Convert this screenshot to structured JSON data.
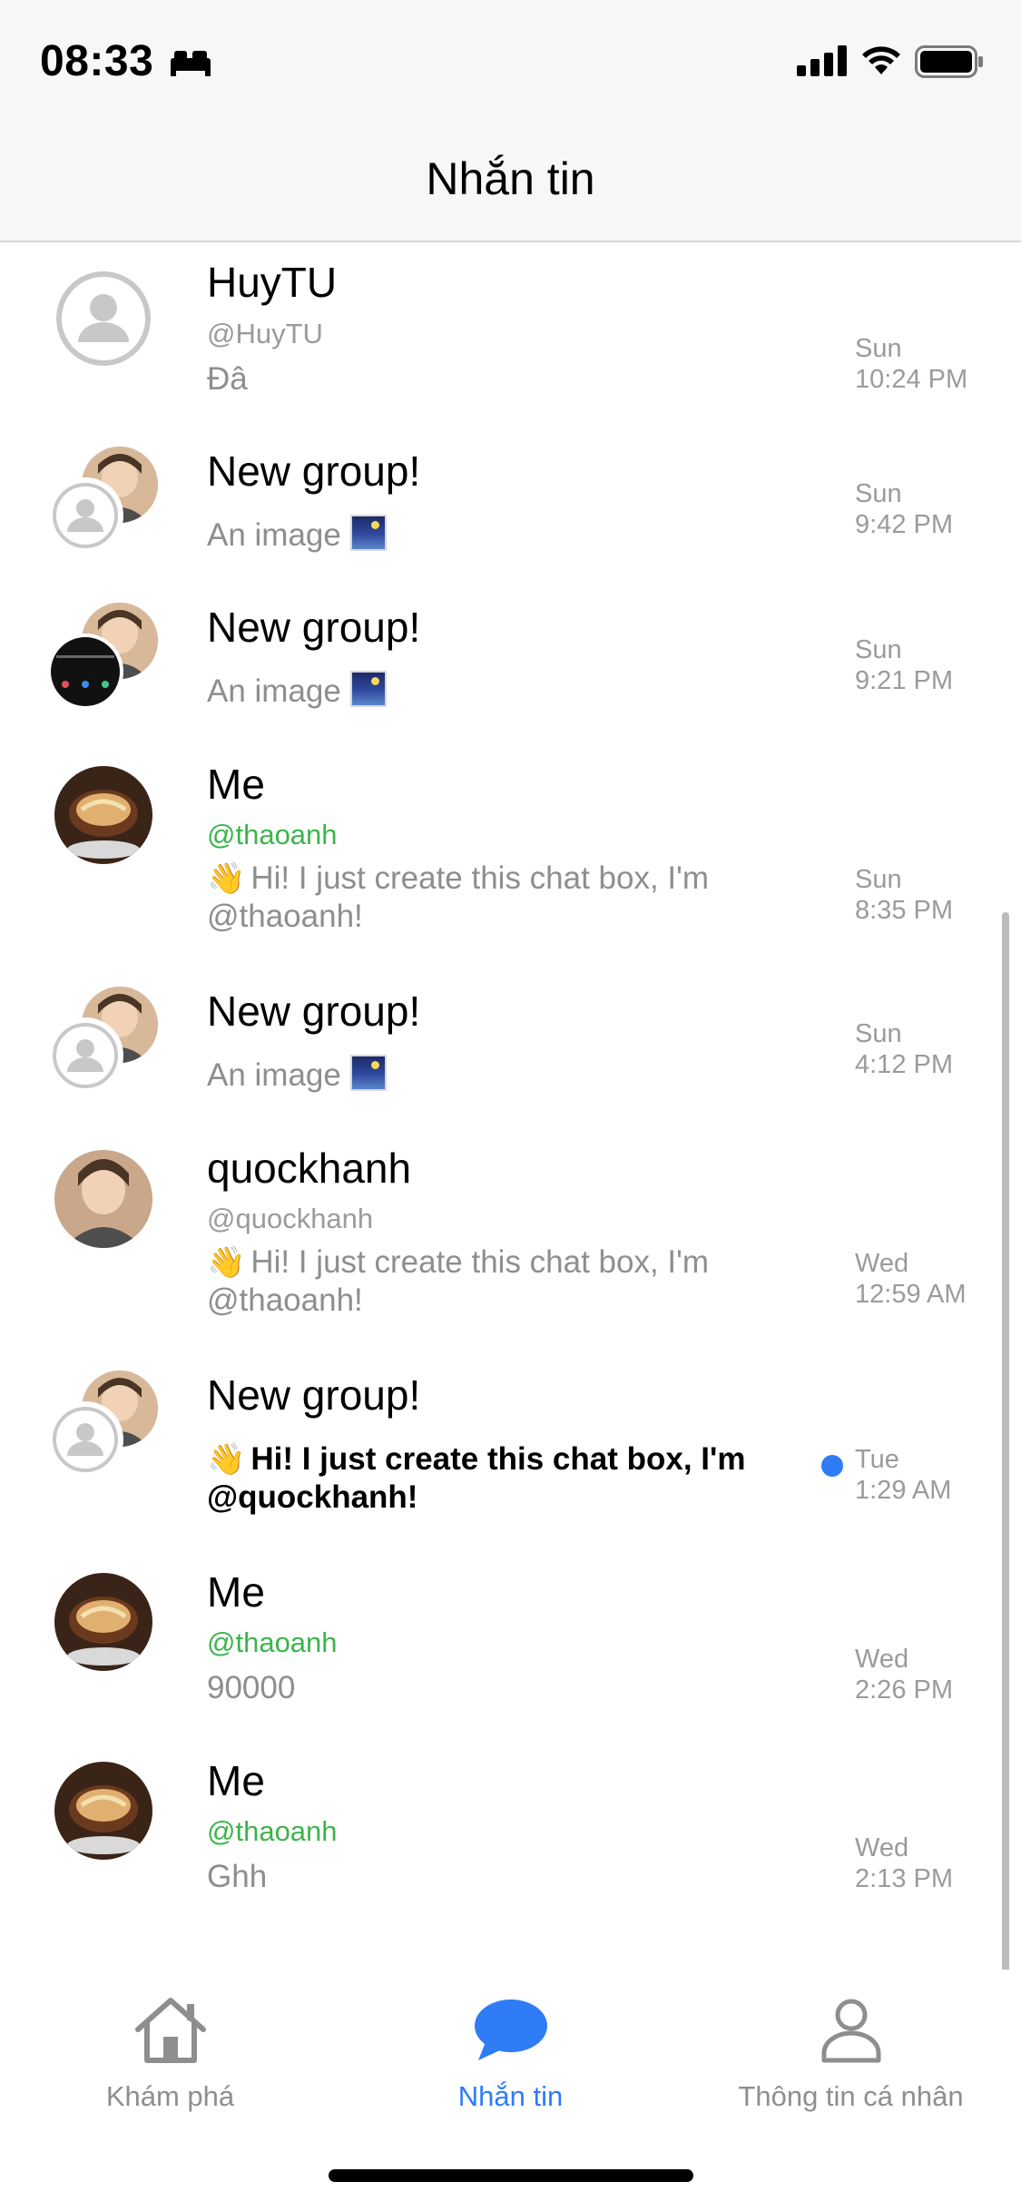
{
  "status_bar": {
    "time": "08:33"
  },
  "nav": {
    "title": "Nhắn tin"
  },
  "conversations": [
    {
      "name": "HuyTU",
      "handle": "@HuyTU",
      "preview": "Đâ",
      "day": "Sun",
      "time": "10:24 PM"
    },
    {
      "name": "New group!",
      "preview": "An image",
      "day": "Sun",
      "time": "9:42 PM"
    },
    {
      "name": "New group!",
      "preview": "An image",
      "day": "Sun",
      "time": "9:21 PM"
    },
    {
      "name": "Me",
      "handle": "@thaoanh",
      "preview": "Hi! I just create this chat box, I'm @thaoanh!",
      "day": "Sun",
      "time": "8:35 PM"
    },
    {
      "name": "New group!",
      "preview": "An image",
      "day": "Sun",
      "time": "4:12 PM"
    },
    {
      "name": "quockhanh",
      "handle": "@quockhanh",
      "preview": "Hi! I just create this chat box, I'm @thaoanh!",
      "day": "Wed",
      "time": "12:59 AM"
    },
    {
      "name": "New group!",
      "preview": "Hi! I just create this chat box, I'm @quockhanh!",
      "day": "Tue",
      "time": "1:29 AM",
      "unread": true
    },
    {
      "name": "Me",
      "handle": "@thaoanh",
      "preview": "90000",
      "day": "Wed",
      "time": "2:26 PM"
    },
    {
      "name": "Me",
      "handle": "@thaoanh",
      "preview": "Ghh",
      "day": "Wed",
      "time": "2:13 PM"
    }
  ],
  "tabs": [
    {
      "label": "Khám phá",
      "icon": "home-icon"
    },
    {
      "label": "Nhắn tin",
      "icon": "chat-bubble-icon",
      "active": true
    },
    {
      "label": "Thông tin cá nhân",
      "icon": "person-icon"
    }
  ],
  "colors": {
    "accent": "#2f7cf6",
    "handle_green": "#3cb44a",
    "unread_dot": "#2f7cf6"
  }
}
